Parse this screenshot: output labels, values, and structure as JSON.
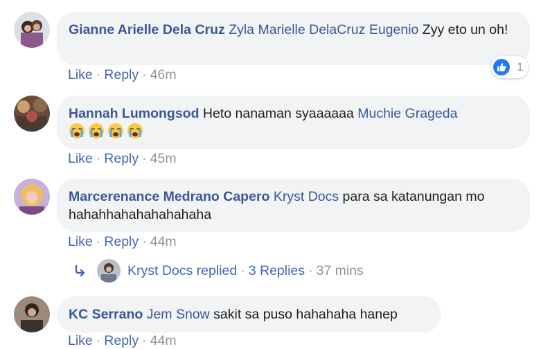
{
  "comments": [
    {
      "author": "Gianne Arielle Dela Cruz",
      "mention": "Zyla Marielle DelaCruz Eugenio",
      "text": " Zyy eto un oh!",
      "actions": {
        "like": "Like",
        "reply": "Reply",
        "time": "46m"
      },
      "reaction": {
        "icon": "thumbs-up-icon",
        "count": "1",
        "color": "#2078f4"
      }
    },
    {
      "author": "Hannah Lumongsod",
      "text": " Heto nanaman syaaaaaa ",
      "mention": "Muchie Grageda",
      "emojis": [
        "crying-face-emoji",
        "crying-face-emoji",
        "crying-face-emoji",
        "crying-face-emoji"
      ],
      "actions": {
        "like": "Like",
        "reply": "Reply",
        "time": "45m"
      }
    },
    {
      "author": "Marcerenance Medrano Capero",
      "mention": "Kryst Docs",
      "text": " para sa katanungan mo hahahhahahahahahaha",
      "actions": {
        "like": "Like",
        "reply": "Reply",
        "time": "44m"
      },
      "replies": {
        "label": "Kryst Docs replied",
        "dot": "·",
        "count": "3 Replies",
        "time": "37 mins"
      }
    },
    {
      "author": "KC Serrano",
      "mention": "Jem Snow",
      "text": " sakit sa puso hahahaha hanep",
      "actions": {
        "like": "Like",
        "reply": "Reply",
        "time": "44m"
      }
    }
  ],
  "colors": {
    "link": "#385898",
    "action": "#4267b2",
    "muted": "#90949c",
    "bubble": "#f2f3f5"
  }
}
